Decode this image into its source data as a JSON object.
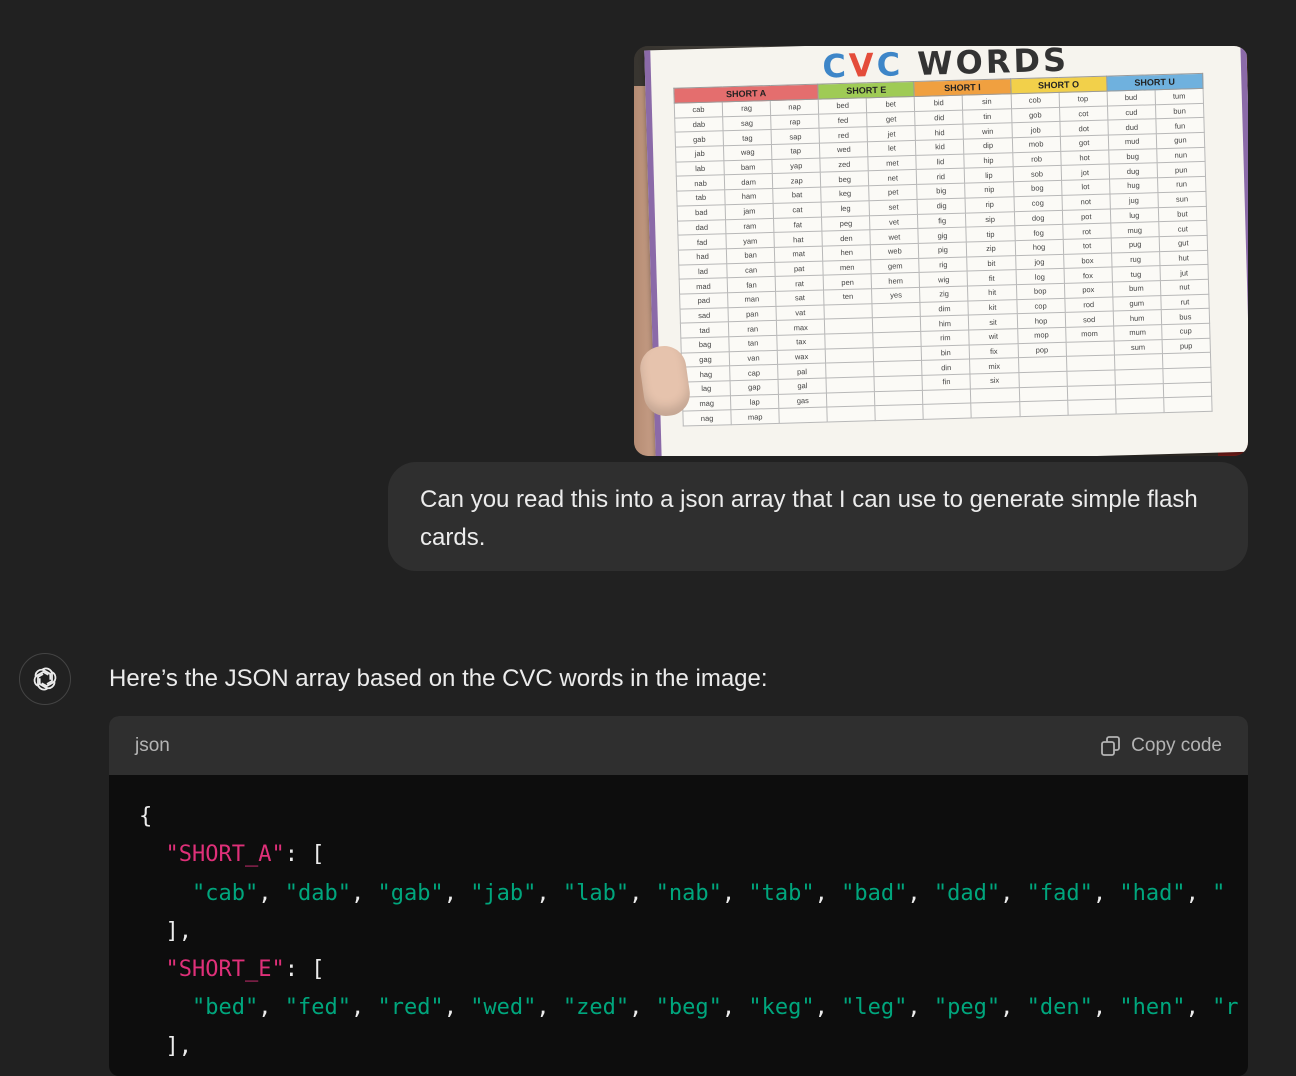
{
  "user_message": {
    "image": {
      "title_parts": [
        "C",
        "V",
        "C",
        "WORDS"
      ],
      "columns": [
        "SHORT A",
        "SHORT E",
        "SHORT I",
        "SHORT O",
        "SHORT U"
      ],
      "header_colors": [
        "#e46e6e",
        "#9fcb55",
        "#f0a040",
        "#f2d04a",
        "#6fb1de"
      ],
      "rows": [
        [
          "cab",
          "rag",
          "nap",
          "bed",
          "bet",
          "bid",
          "sin",
          "cob",
          "top",
          "bud",
          "tum"
        ],
        [
          "dab",
          "sag",
          "rap",
          "fed",
          "get",
          "did",
          "tin",
          "gob",
          "cot",
          "cud",
          "bun"
        ],
        [
          "gab",
          "tag",
          "sap",
          "red",
          "jet",
          "hid",
          "win",
          "job",
          "dot",
          "dud",
          "fun"
        ],
        [
          "jab",
          "wag",
          "tap",
          "wed",
          "let",
          "kid",
          "dip",
          "mob",
          "got",
          "mud",
          "gun"
        ],
        [
          "lab",
          "bam",
          "yap",
          "zed",
          "met",
          "lid",
          "hip",
          "rob",
          "hot",
          "bug",
          "nun"
        ],
        [
          "nab",
          "dam",
          "zap",
          "beg",
          "net",
          "rid",
          "lip",
          "sob",
          "jot",
          "dug",
          "pun"
        ],
        [
          "tab",
          "ham",
          "bat",
          "keg",
          "pet",
          "big",
          "nip",
          "bog",
          "lot",
          "hug",
          "run"
        ],
        [
          "bad",
          "jam",
          "cat",
          "leg",
          "set",
          "dig",
          "rip",
          "cog",
          "not",
          "jug",
          "sun"
        ],
        [
          "dad",
          "ram",
          "fat",
          "peg",
          "vet",
          "fig",
          "sip",
          "dog",
          "pot",
          "lug",
          "but"
        ],
        [
          "fad",
          "yam",
          "hat",
          "den",
          "wet",
          "gig",
          "tip",
          "fog",
          "rot",
          "mug",
          "cut"
        ],
        [
          "had",
          "ban",
          "mat",
          "hen",
          "web",
          "pig",
          "zip",
          "hog",
          "tot",
          "pug",
          "gut"
        ],
        [
          "lad",
          "can",
          "pat",
          "men",
          "gem",
          "rig",
          "bit",
          "jog",
          "box",
          "rug",
          "hut"
        ],
        [
          "mad",
          "fan",
          "rat",
          "pen",
          "hem",
          "wig",
          "fit",
          "log",
          "fox",
          "tug",
          "jut"
        ],
        [
          "pad",
          "man",
          "sat",
          "ten",
          "yes",
          "zig",
          "hit",
          "bop",
          "pox",
          "bum",
          "nut"
        ],
        [
          "sad",
          "pan",
          "vat",
          "",
          "",
          "dim",
          "kit",
          "cop",
          "rod",
          "gum",
          "rut"
        ],
        [
          "tad",
          "ran",
          "max",
          "",
          "",
          "him",
          "sit",
          "hop",
          "sod",
          "hum",
          "bus"
        ],
        [
          "bag",
          "tan",
          "tax",
          "",
          "",
          "rim",
          "wit",
          "mop",
          "mom",
          "mum",
          "cup"
        ],
        [
          "gag",
          "van",
          "wax",
          "",
          "",
          "bin",
          "fix",
          "pop",
          "",
          "sum",
          "pup"
        ],
        [
          "hag",
          "cap",
          "pal",
          "",
          "",
          "din",
          "mix",
          "",
          "",
          "",
          ""
        ],
        [
          "lag",
          "gap",
          "gal",
          "",
          "",
          "fin",
          "six",
          "",
          "",
          "",
          ""
        ],
        [
          "mag",
          "lap",
          "gas",
          "",
          "",
          "",
          "",
          "",
          "",
          "",
          ""
        ],
        [
          "nag",
          "map",
          "",
          "",
          "",
          "",
          "",
          "",
          "",
          "",
          ""
        ]
      ]
    },
    "text": "Can you read this into a json array that I can use to generate simple flash cards."
  },
  "assistant": {
    "intro": "Here’s the JSON array based on the CVC words in the image:",
    "code_block": {
      "language": "json",
      "copy_label": "Copy code",
      "open_brace": "{",
      "short_a_key": "\"SHORT_A\"",
      "short_a_words": [
        "\"cab\"",
        "\"dab\"",
        "\"gab\"",
        "\"jab\"",
        "\"lab\"",
        "\"nab\"",
        "\"tab\"",
        "\"bad\"",
        "\"dad\"",
        "\"fad\"",
        "\"had\"",
        "\""
      ],
      "short_e_key": "\"SHORT_E\"",
      "short_e_words": [
        "\"bed\"",
        "\"fed\"",
        "\"red\"",
        "\"wed\"",
        "\"zed\"",
        "\"beg\"",
        "\"keg\"",
        "\"leg\"",
        "\"peg\"",
        "\"den\"",
        "\"hen\"",
        "\"r"
      ],
      "array_open": ": [",
      "array_close": "],"
    }
  }
}
